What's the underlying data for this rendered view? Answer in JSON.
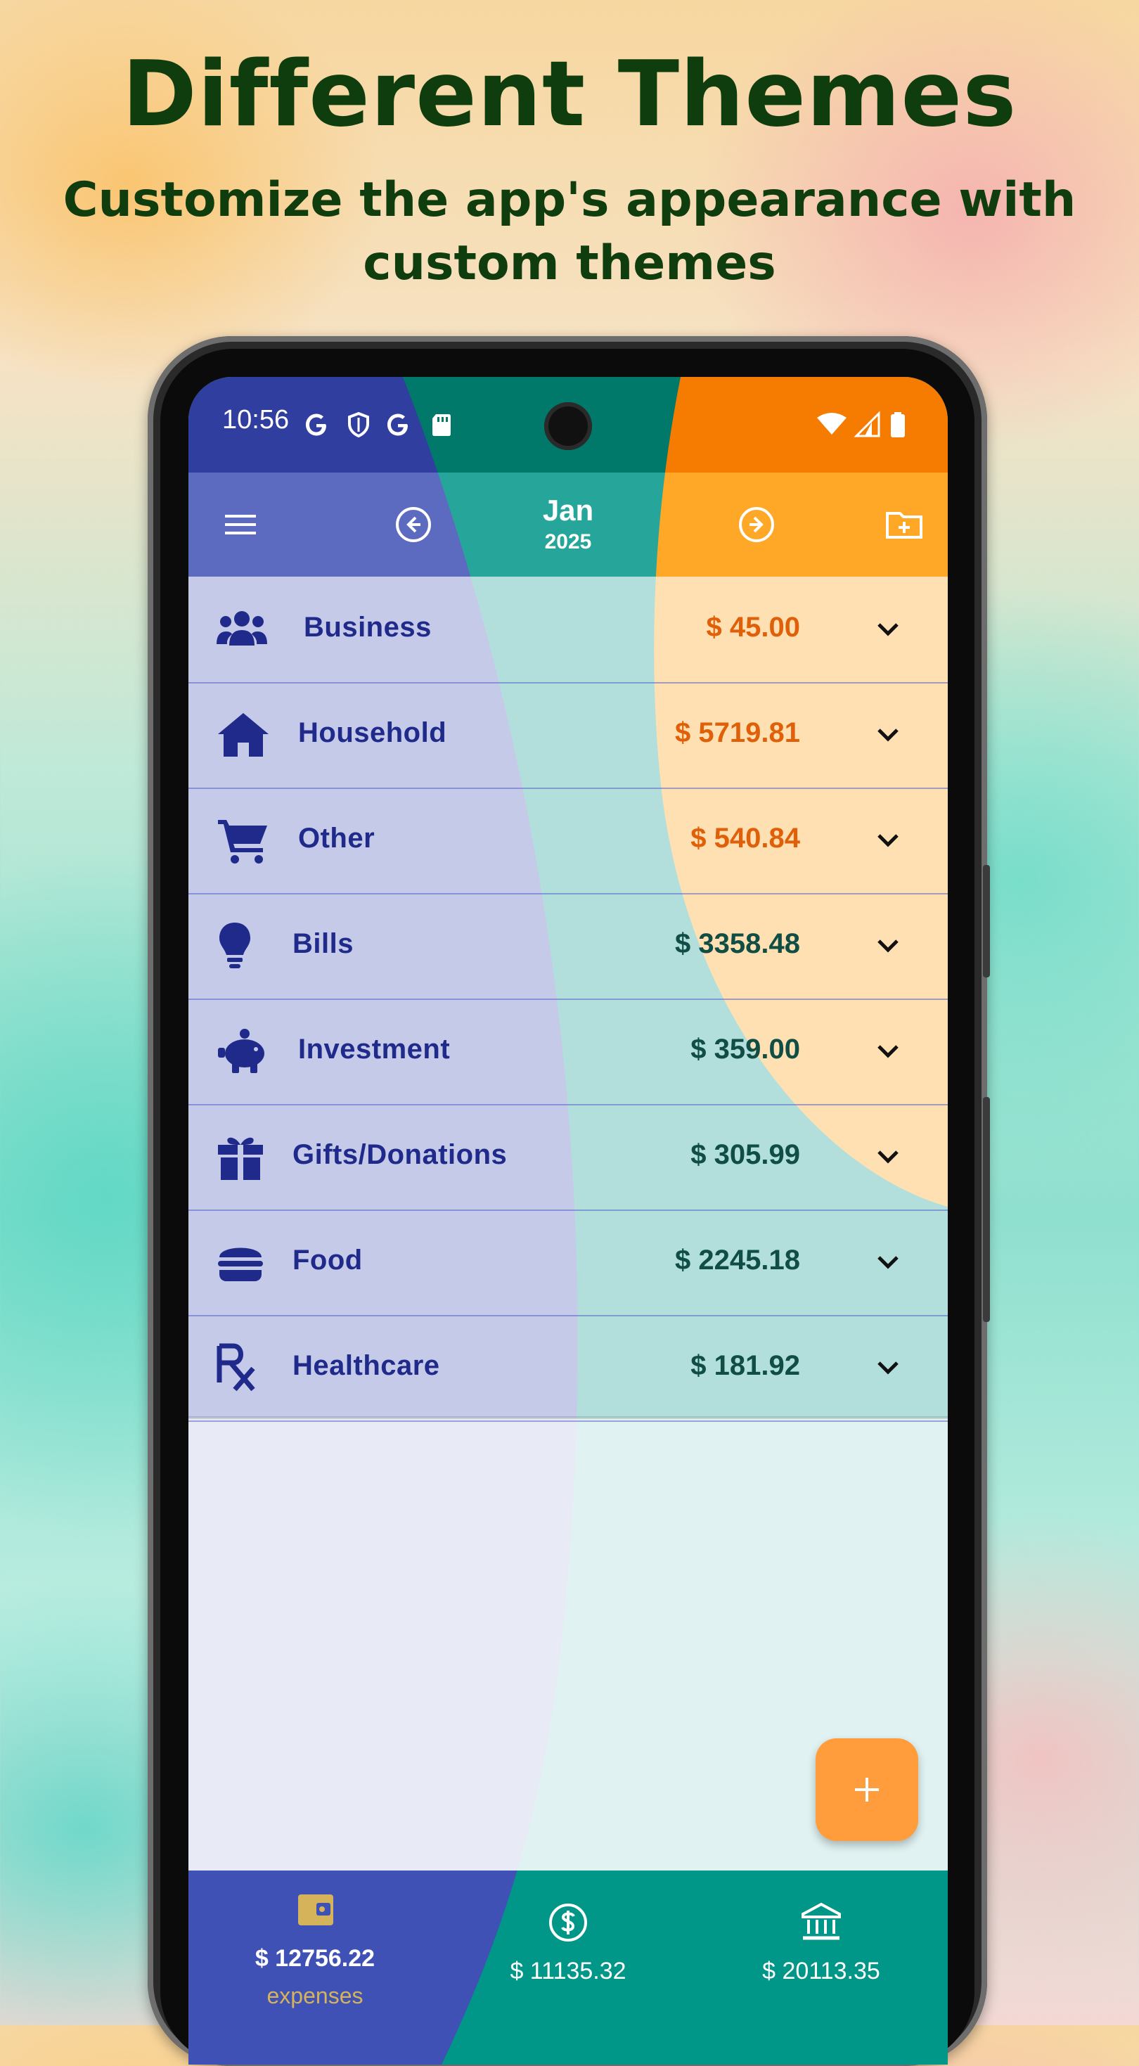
{
  "promo": {
    "title": "Different Themes",
    "subtitle": "Customize the app's appearance with custom themes"
  },
  "status_bar": {
    "time": "10:56",
    "left_icons": [
      "google-icon",
      "shield-icon",
      "google-icon",
      "sd-card-icon"
    ],
    "right_icons": [
      "wifi-icon",
      "signal-icon",
      "battery-icon"
    ]
  },
  "app_bar": {
    "menu_icon": "menu-icon",
    "prev_icon": "arrow-left-circle-icon",
    "next_icon": "arrow-right-circle-icon",
    "add_folder_icon": "folder-plus-icon",
    "month": "Jan",
    "year": "2025"
  },
  "categories": [
    {
      "label": "Business",
      "amount": "$ 45.00",
      "icon": "people-icon"
    },
    {
      "label": "Household",
      "amount": "$ 5719.81",
      "icon": "home-icon"
    },
    {
      "label": "Other",
      "amount": "$ 540.84",
      "icon": "cart-icon"
    },
    {
      "label": "Bills",
      "amount": "$ 3358.48",
      "icon": "lightbulb-icon"
    },
    {
      "label": "Investment",
      "amount": "$ 359.00",
      "icon": "piggy-bank-icon"
    },
    {
      "label": "Gifts/Donations",
      "amount": "$ 305.99",
      "icon": "gift-icon"
    },
    {
      "label": "Food",
      "amount": "$ 2245.18",
      "icon": "burger-icon"
    },
    {
      "label": "Healthcare",
      "amount": "$ 181.92",
      "icon": "prescription-icon"
    }
  ],
  "fab": {
    "icon": "plus-icon"
  },
  "bottom_nav": {
    "expenses": {
      "amount": "$ 12756.22",
      "caption": "expenses",
      "icon": "wallet-icon"
    },
    "income": {
      "amount": "$ 11135.32",
      "icon": "dollar-circle-icon"
    },
    "balance": {
      "amount": "$ 20113.35",
      "icon": "bank-icon"
    }
  },
  "colors": {
    "indigo_theme": "#3f51b5",
    "teal_theme": "#009688",
    "orange_theme": "#ff9800",
    "text_dark_green": "#0f3d0d",
    "amount_orange": "#e0600a",
    "amount_teal": "#0f4d45"
  }
}
